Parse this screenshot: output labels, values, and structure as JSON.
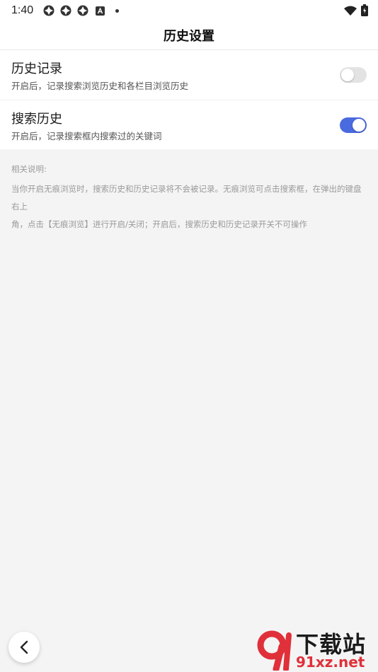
{
  "status_bar": {
    "time": "1:40",
    "icons": [
      "app-notification-icon",
      "app-notification-icon",
      "app-notification-icon",
      "a-box-icon",
      "more-dot-icon"
    ],
    "right_icons": [
      "wifi-icon",
      "battery-icon"
    ]
  },
  "header": {
    "title": "历史设置"
  },
  "settings": [
    {
      "title": "历史记录",
      "description": "开启后，记录搜索浏览历史和各栏目浏览历史",
      "enabled": false
    },
    {
      "title": "搜索历史",
      "description": "开启后，记录搜索框内搜索过的关键词",
      "enabled": true
    }
  ],
  "note": {
    "title": "相关说明:",
    "body_line1": "当你开启无痕浏览时，搜索历史和历史记录将不会被记录。无痕浏览可点击搜索框，在弹出的键盘右上",
    "body_line2": "角，点击【无痕浏览】进行开启/关闭；开启后，搜索历史和历史记录开关不可操作"
  },
  "watermark": {
    "top": "下载站",
    "bottom": "91xz.net"
  },
  "colors": {
    "accent": "#4a6ae0",
    "toggle_off": "#e3e3e3",
    "background": "#f4f4f4"
  }
}
